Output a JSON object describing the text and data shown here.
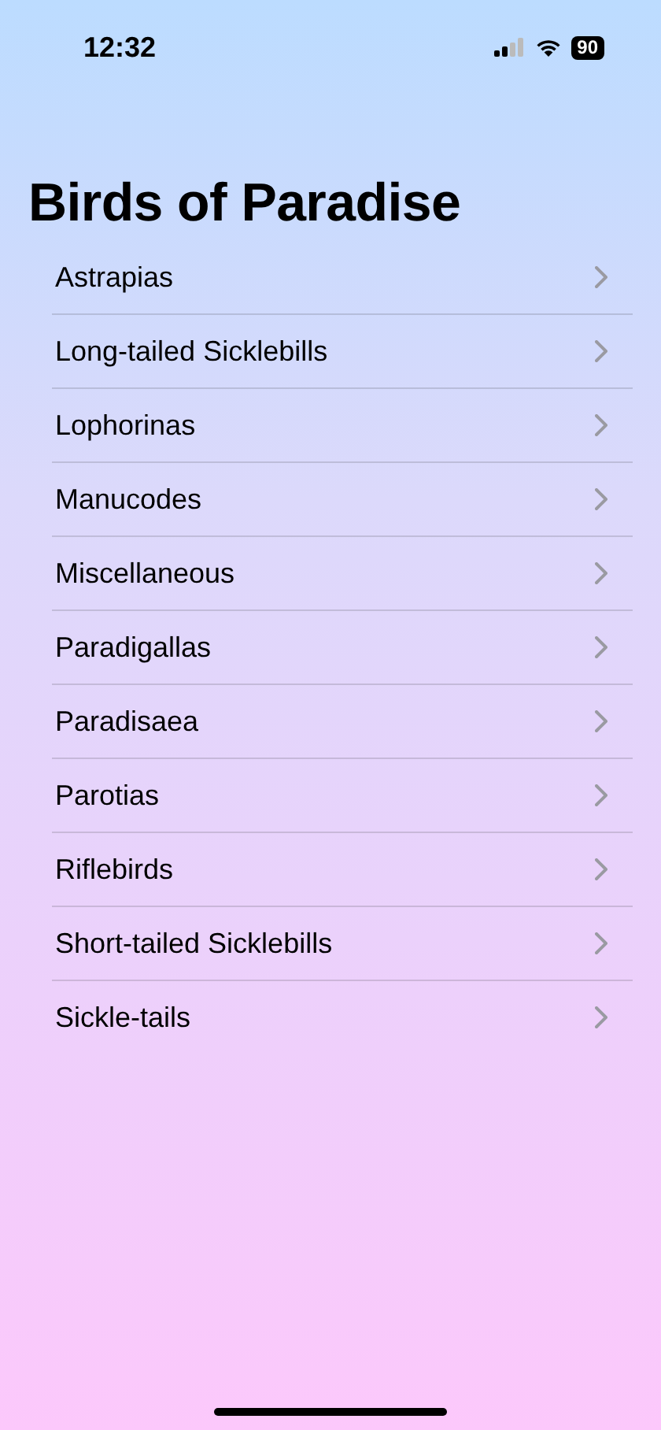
{
  "status_bar": {
    "time": "12:32",
    "battery": "90"
  },
  "title": "Birds of Paradise",
  "items": [
    {
      "label": "Astrapias"
    },
    {
      "label": "Long-tailed Sicklebills"
    },
    {
      "label": "Lophorinas"
    },
    {
      "label": "Manucodes"
    },
    {
      "label": "Miscellaneous"
    },
    {
      "label": "Paradigallas"
    },
    {
      "label": "Paradisaea"
    },
    {
      "label": "Parotias"
    },
    {
      "label": "Riflebirds"
    },
    {
      "label": "Short-tailed Sicklebills"
    },
    {
      "label": "Sickle-tails"
    }
  ]
}
